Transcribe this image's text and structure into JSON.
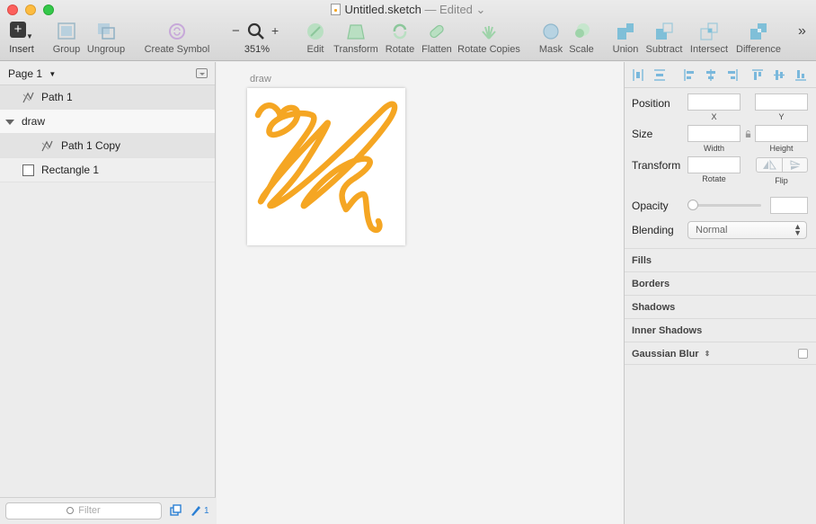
{
  "window": {
    "title": "Untitled.sketch",
    "status": "— Edited",
    "status_caret": "⌄"
  },
  "toolbar": {
    "insert": "Insert",
    "group": "Group",
    "ungroup": "Ungroup",
    "create_symbol": "Create Symbol",
    "zoom_out": "−",
    "zoom_in": "+",
    "zoom_level": "351%",
    "edit": "Edit",
    "transform": "Transform",
    "rotate": "Rotate",
    "flatten": "Flatten",
    "rotate_copies": "Rotate Copies",
    "mask": "Mask",
    "scale": "Scale",
    "union": "Union",
    "subtract": "Subtract",
    "intersect": "Intersect",
    "difference": "Difference",
    "overflow": "»"
  },
  "layers": {
    "page_selector": "Page 1",
    "items": [
      {
        "label": "Path 1"
      },
      {
        "label": "draw"
      },
      {
        "label": "Path 1 Copy"
      },
      {
        "label": "Rectangle 1"
      }
    ],
    "filter_placeholder": "Filter",
    "edited_count": "1"
  },
  "canvas": {
    "artboard_name": "draw",
    "stroke_color": "#f5a623"
  },
  "inspector": {
    "position_label": "Position",
    "x_label": "X",
    "y_label": "Y",
    "size_label": "Size",
    "width_label": "Width",
    "height_label": "Height",
    "transform_label": "Transform",
    "rotate_label": "Rotate",
    "flip_label": "Flip",
    "opacity_label": "Opacity",
    "blending_label": "Blending",
    "blending_value": "Normal",
    "sections": [
      "Fills",
      "Borders",
      "Shadows",
      "Inner Shadows",
      "Gaussian Blur"
    ]
  },
  "colors": {
    "accent": "#4a90e2",
    "toolbar_icon": "#5fa8c8",
    "stroke": "#f5a623"
  }
}
